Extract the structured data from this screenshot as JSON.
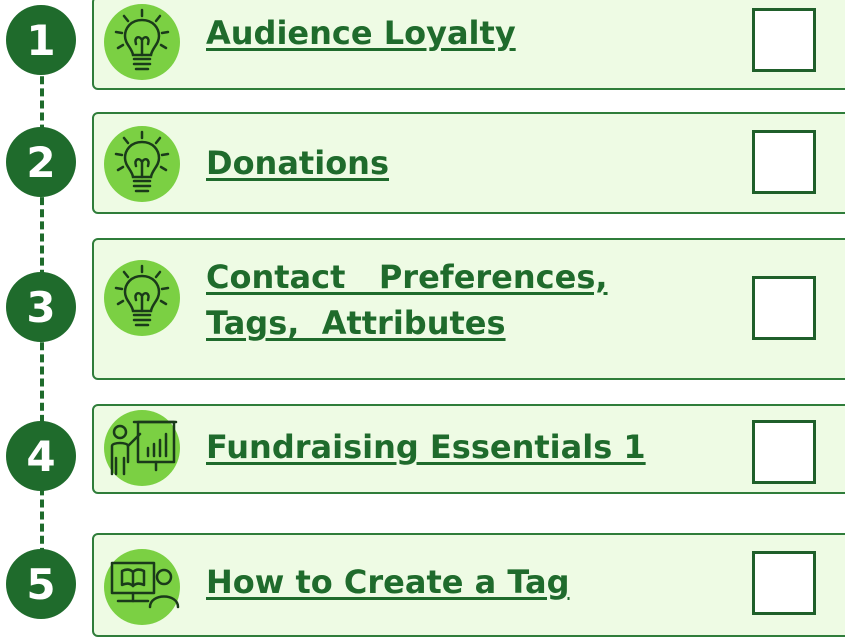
{
  "colors": {
    "accent_dark": "#1f6b2c",
    "card_bg": "#eefbe4",
    "icon_bg": "#7bd043"
  },
  "steps": [
    {
      "number": "1",
      "title": "Audience Loyalty",
      "icon": "lightbulb-icon",
      "checked": false
    },
    {
      "number": "2",
      "title": "Donations",
      "icon": "lightbulb-icon",
      "checked": false
    },
    {
      "number": "3",
      "title_lines": [
        "Contact   Preferences,",
        "Tags,  Attributes"
      ],
      "icon": "lightbulb-icon",
      "checked": false
    },
    {
      "number": "4",
      "title": "Fundraising Essentials 1",
      "icon": "presentation-icon",
      "checked": false
    },
    {
      "number": "5",
      "title": "How to Create a Tag",
      "icon": "online-course-icon",
      "checked": false
    }
  ]
}
